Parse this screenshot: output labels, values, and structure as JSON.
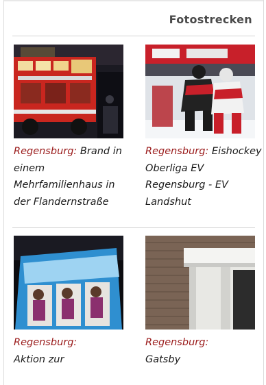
{
  "header": {
    "title": "Fotostrecken"
  },
  "items": [
    {
      "city": "Regensburg:",
      "title": "Brand in einem Mehrfamilienhaus in der Flandernstraße",
      "image_icon": "fire-truck-photo"
    },
    {
      "city": "Regensburg:",
      "title": "Eishockey Oberliga EV Regensburg - EV Landshut",
      "image_icon": "ice-hockey-photo"
    },
    {
      "city": "Regensburg:",
      "title": "Aktion zur",
      "image_icon": "flyers-photo"
    },
    {
      "city": "Regensburg:",
      "title": "Gatsby",
      "image_icon": "building-entrance-photo"
    }
  ],
  "colors": {
    "city": "#9a1a1a",
    "title": "#4a4a4a",
    "divider": "#d3d3d3"
  }
}
